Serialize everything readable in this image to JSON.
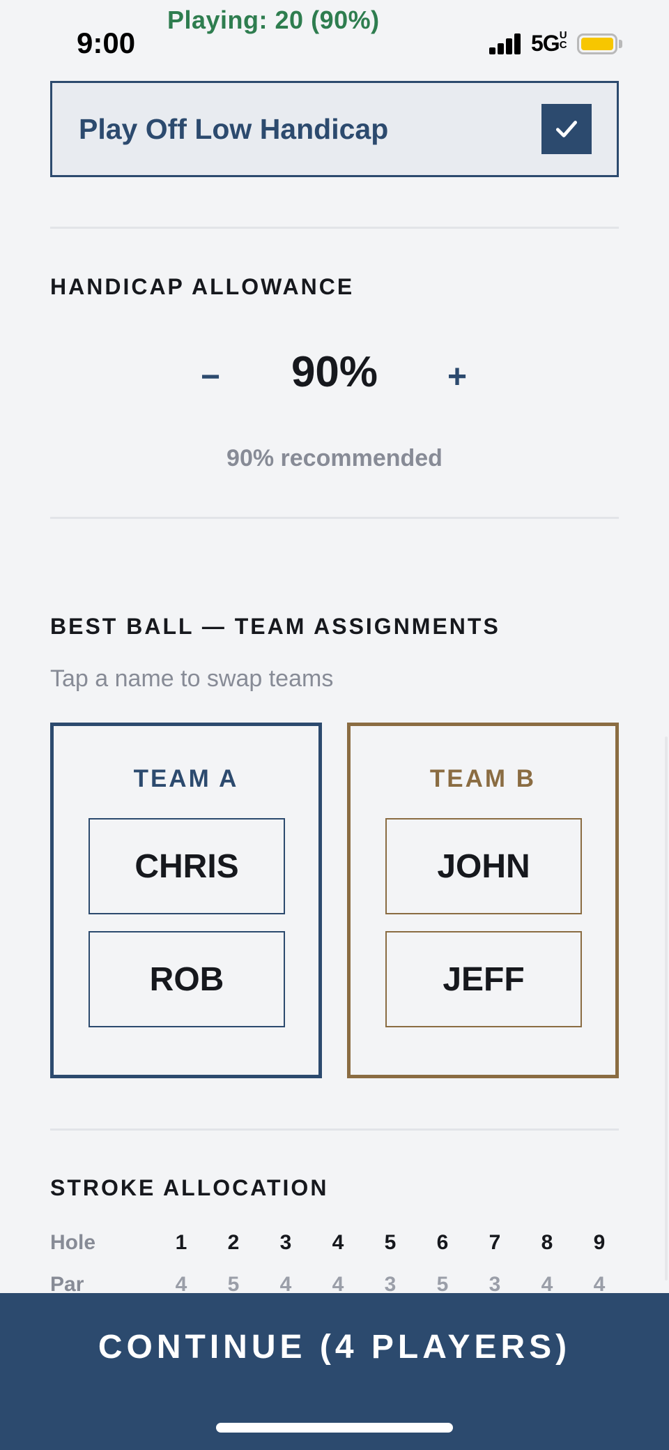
{
  "status_bar": {
    "time": "9:00",
    "banner": "Playing: 20 (90%)",
    "network": "5G",
    "network_suffix": "UC",
    "battery_color": "#f7c600"
  },
  "play_off_low": {
    "label": "Play Off Low Handicap",
    "checked": true
  },
  "handicap_allowance": {
    "title": "HANDICAP ALLOWANCE",
    "minus_label": "−",
    "value": "90%",
    "plus_label": "+",
    "recommendation": "90% recommended"
  },
  "teams_section": {
    "title": "BEST BALL — TEAM ASSIGNMENTS",
    "hint": "Tap a name to swap teams",
    "teams": [
      {
        "name": "TEAM A",
        "color": "#2c4a6e",
        "players": [
          "CHRIS",
          "ROB"
        ]
      },
      {
        "name": "TEAM B",
        "color": "#8a6c42",
        "players": [
          "JOHN",
          "JEFF"
        ]
      }
    ]
  },
  "stroke_allocation": {
    "title": "STROKE ALLOCATION",
    "hole_label": "Hole",
    "par_label": "Par",
    "holes": [
      "1",
      "2",
      "3",
      "4",
      "5",
      "6",
      "7",
      "8",
      "9"
    ],
    "pars": [
      "4",
      "5",
      "4",
      "4",
      "3",
      "5",
      "3",
      "4",
      "4"
    ]
  },
  "continue_button": {
    "label": "CONTINUE (4 PLAYERS)"
  },
  "colors": {
    "navy": "#2c4a6e",
    "gold": "#8a6c42",
    "green": "#2e7d4f",
    "background": "#f3f4f6"
  }
}
